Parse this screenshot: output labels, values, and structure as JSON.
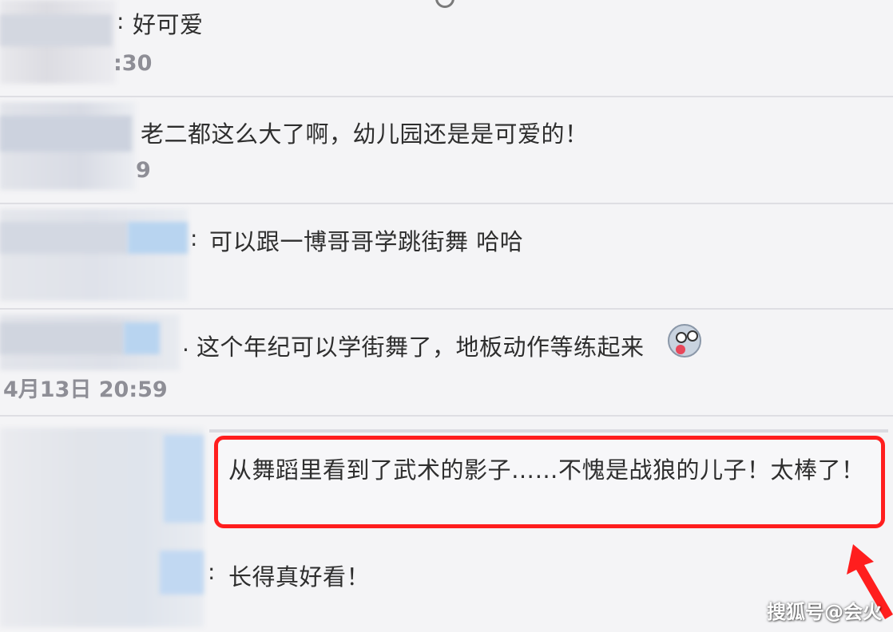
{
  "comments": [
    {
      "text": "好可爱",
      "time": ":30"
    },
    {
      "text": "老二都这么大了啊，幼儿园还是是可爱的！",
      "time": "9"
    },
    {
      "text": "可以跟一博哥哥学跳街舞 哈哈",
      "time": ""
    },
    {
      "text": "这个年纪可以学街舞了，地板动作等练起来",
      "time": "4月13日 20:59",
      "emoji": "surprised-face-emoji"
    }
  ],
  "highlighted_reply": {
    "text": "从舞蹈里看到了武术的影子……不愧是战狼的儿子！太棒了！"
  },
  "last_reply": {
    "text": "长得真好看！"
  },
  "watermark": "搜狐号@会火",
  "colors": {
    "highlight_border": "#ff1e1e",
    "arrow": "#ff1e1e",
    "background": "#f4f4f6"
  }
}
